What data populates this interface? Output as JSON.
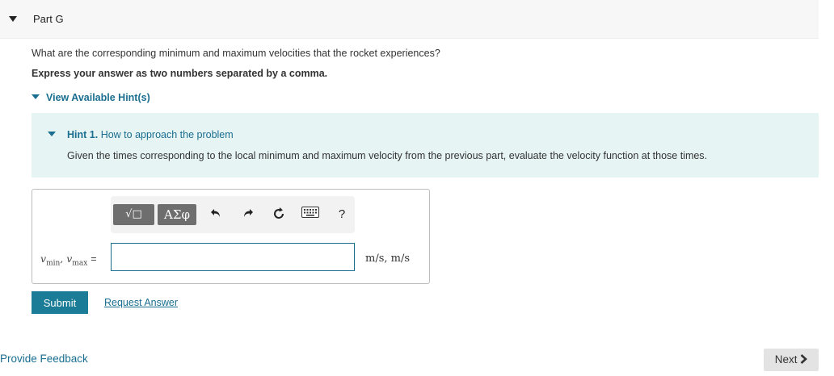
{
  "part": {
    "title": "Part G"
  },
  "question": "What are the corresponding minimum and maximum velocities that the rocket experiences?",
  "instruction": "Express your answer as two numbers separated by a comma.",
  "hints": {
    "toggle_label": "View Available Hint(s)",
    "items": [
      {
        "number": "Hint 1.",
        "title": "How to approach the problem",
        "body": "Given the times corresponding to the local minimum and maximum velocity from the previous part, evaluate the velocity function at those times."
      }
    ]
  },
  "toolbar": {
    "template_label": "√□",
    "greek_label": "ΑΣφ",
    "undo_icon": "undo-icon",
    "redo_icon": "redo-icon",
    "reset_icon": "reset-icon",
    "keyboard_icon": "keyboard-icon",
    "help_label": "?"
  },
  "answer": {
    "var1": "v",
    "var1_sub": "min",
    "separator": ", ",
    "var2": "v",
    "var2_sub": "max",
    "equals": "=",
    "value": "",
    "units": "m/s, m/s"
  },
  "actions": {
    "submit_label": "Submit",
    "request_answer_label": "Request Answer"
  },
  "footer": {
    "feedback_label": "Provide Feedback",
    "next_label": "Next",
    "next_icon": "chevron-right-icon"
  },
  "colors": {
    "accent": "#1a6e8f",
    "submit": "#1a7c96",
    "hint_bg": "#e6f4f4"
  }
}
